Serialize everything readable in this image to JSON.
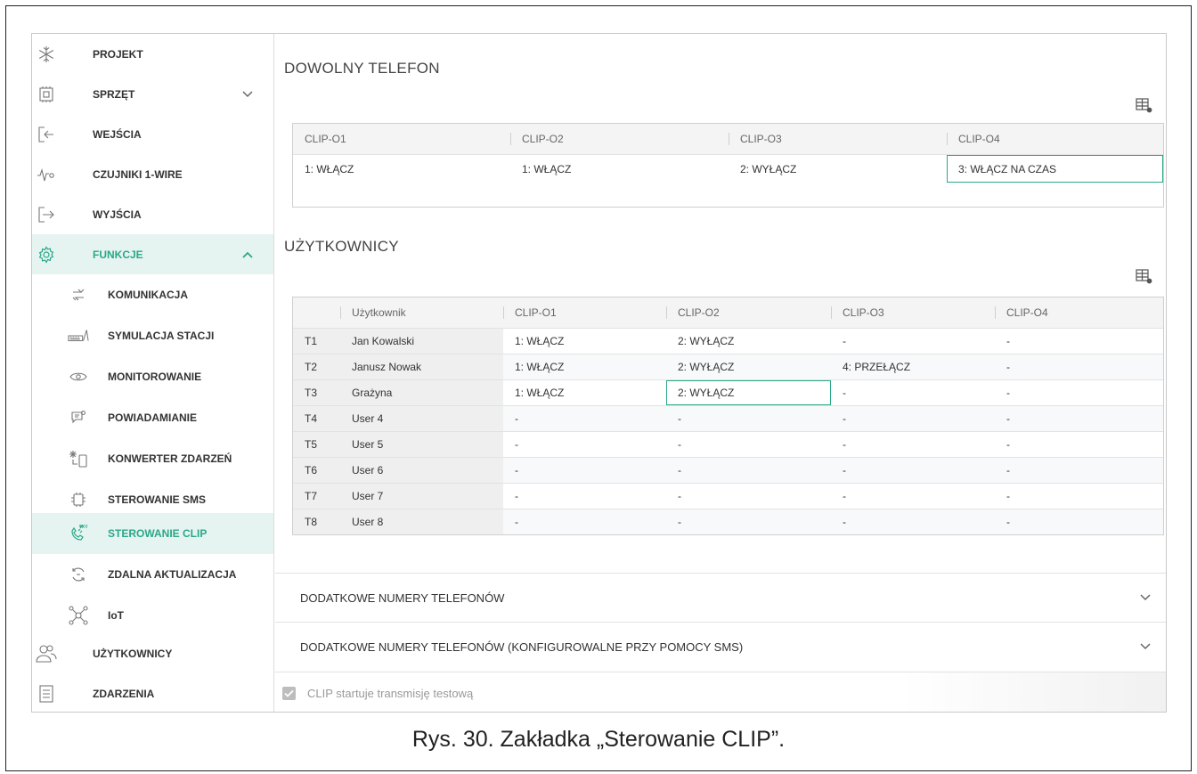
{
  "sidebar": {
    "items": [
      {
        "label": "PROJEKT",
        "icon": "snowflake-icon"
      },
      {
        "label": "SPRZĘT",
        "icon": "chip-icon"
      },
      {
        "label": "WEJŚCIA",
        "icon": "input-icon"
      },
      {
        "label": "CZUJNIKI 1-WIRE",
        "icon": "sensor-icon"
      },
      {
        "label": "WYJŚCIA",
        "icon": "output-icon"
      },
      {
        "label": "FUNKCJE",
        "icon": "gear-icon"
      },
      {
        "label": "UŻYTKOWNICY",
        "icon": "users-icon"
      },
      {
        "label": "ZDARZENIA",
        "icon": "list-icon"
      }
    ],
    "sub_items": [
      {
        "label": "KOMUNIKACJA",
        "icon": "arrows-icon"
      },
      {
        "label": "SYMULACJA STACJI",
        "icon": "station-icon"
      },
      {
        "label": "MONITOROWANIE",
        "icon": "eye-icon"
      },
      {
        "label": "POWIADAMIANIE",
        "icon": "notification-icon"
      },
      {
        "label": "KONWERTER ZDARZEŃ",
        "icon": "converter-icon"
      },
      {
        "label": "STEROWANIE SMS",
        "icon": "sms-icon"
      },
      {
        "label": "STEROWANIE CLIP",
        "icon": "phone-clip-icon"
      },
      {
        "label": "ZDALNA AKTUALIZACJA",
        "icon": "update-icon"
      },
      {
        "label": "IoT",
        "icon": "network-icon"
      }
    ],
    "active_color": "#2aa889"
  },
  "any_phone": {
    "title": "DOWOLNY TELEFON",
    "headers": [
      "CLIP-O1",
      "CLIP-O2",
      "CLIP-O3",
      "CLIP-O4"
    ],
    "values": [
      "1: WŁĄCZ",
      "1: WŁĄCZ",
      "2: WYŁĄCZ",
      "3: WŁĄCZ NA CZAS"
    ]
  },
  "users": {
    "title": "UŻYTKOWNICY",
    "headers": [
      "",
      "Użytkownik",
      "CLIP-O1",
      "CLIP-O2",
      "CLIP-O3",
      "CLIP-O4"
    ],
    "rows": [
      [
        "T1",
        "Jan Kowalski",
        "1: WŁĄCZ",
        "2: WYŁĄCZ",
        "-",
        "-"
      ],
      [
        "T2",
        "Janusz Nowak",
        "1: WŁĄCZ",
        "2: WYŁĄCZ",
        "4: PRZEŁĄCZ",
        "-"
      ],
      [
        "T3",
        "Grażyna",
        "1: WŁĄCZ",
        "2: WYŁĄCZ",
        "-",
        "-"
      ],
      [
        "T4",
        "User 4",
        "-",
        "-",
        "-",
        "-"
      ],
      [
        "T5",
        "User 5",
        "-",
        "-",
        "-",
        "-"
      ],
      [
        "T6",
        "User 6",
        "-",
        "-",
        "-",
        "-"
      ],
      [
        "T7",
        "User 7",
        "-",
        "-",
        "-",
        "-"
      ],
      [
        "T8",
        "User 8",
        "-",
        "-",
        "-",
        "-"
      ]
    ]
  },
  "accordions": [
    "DODATKOWE NUMERY TELEFONÓW",
    "DODATKOWE NUMERY TELEFONÓW (KONFIGUROWALNE PRZY POMOCY SMS)"
  ],
  "checkbox": {
    "label": "CLIP startuje transmisję testową",
    "checked": true
  },
  "caption": "Rys. 30. Zakładka „Sterowanie CLIP”."
}
